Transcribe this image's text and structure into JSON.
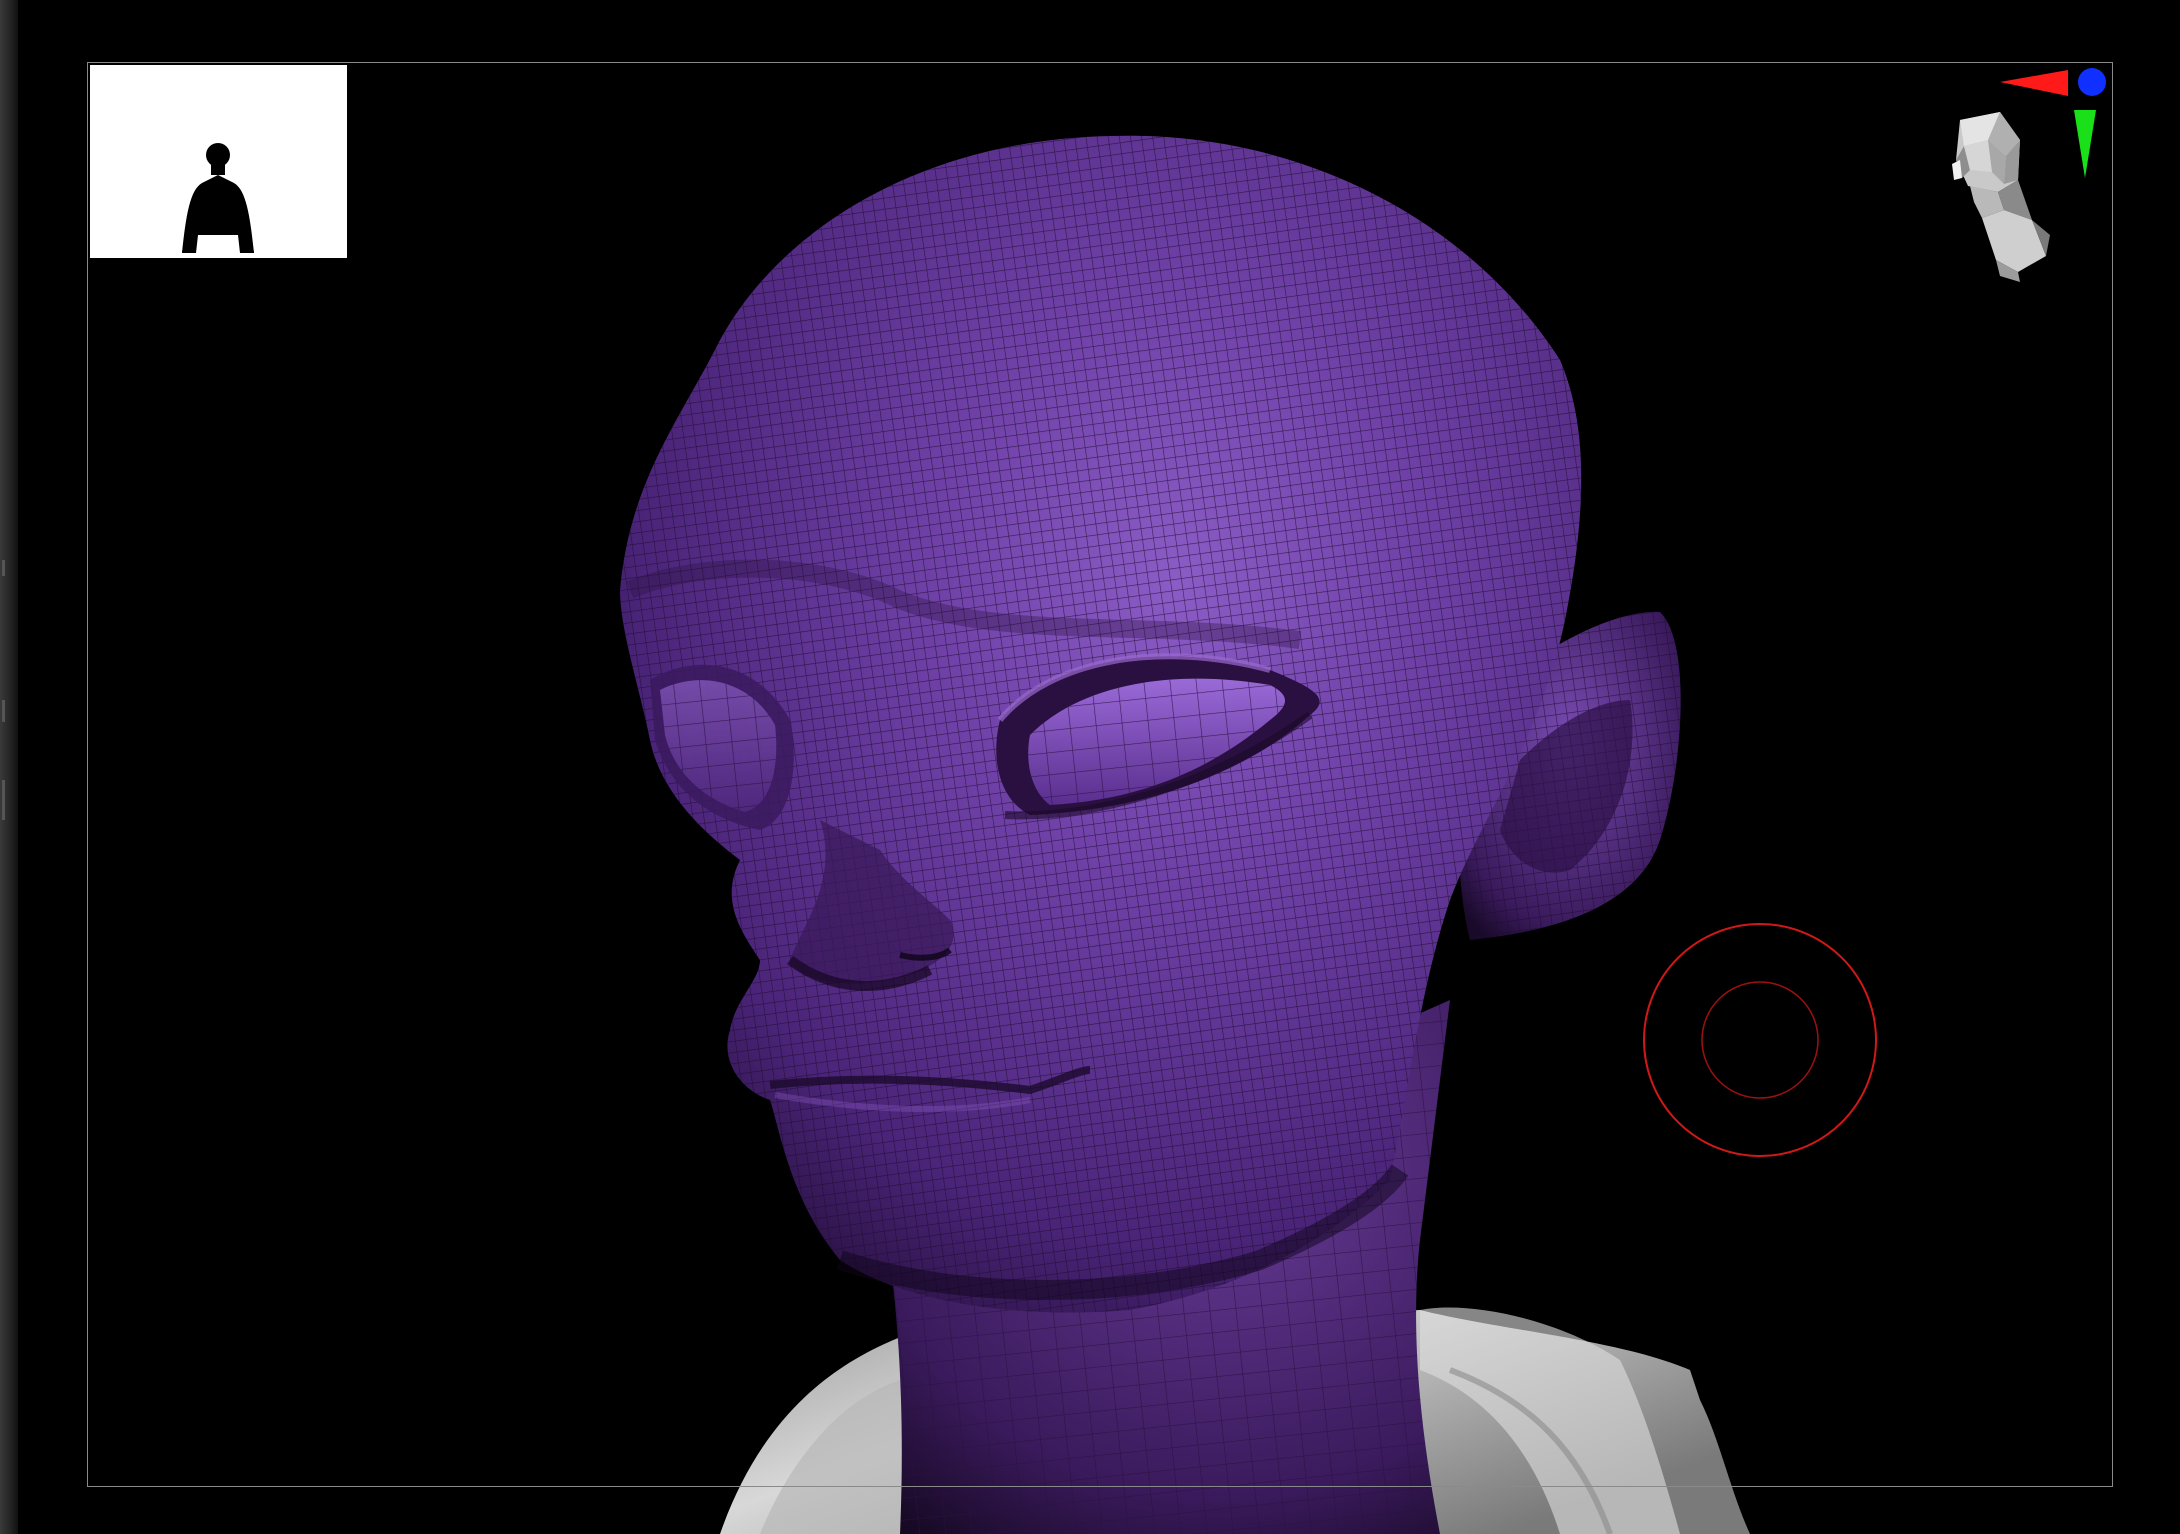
{
  "viewport": {
    "model": "purple-head-mesh",
    "background": "#000000",
    "mesh_color": "#6a3d9a",
    "wire_color": "#2b1040",
    "cloth_color": "#c8c8c8"
  },
  "navigation": {
    "axis_x_color": "#ff1a1a",
    "axis_y_color": "#19e019",
    "axis_z_color": "#1030ff",
    "icon": "head-navigator-icon"
  },
  "brush": {
    "color": "#d01818",
    "icon": "brush-cursor-icon"
  },
  "thumbnail": {
    "icon": "silhouette-thumbnail-icon",
    "background": "#ffffff"
  }
}
